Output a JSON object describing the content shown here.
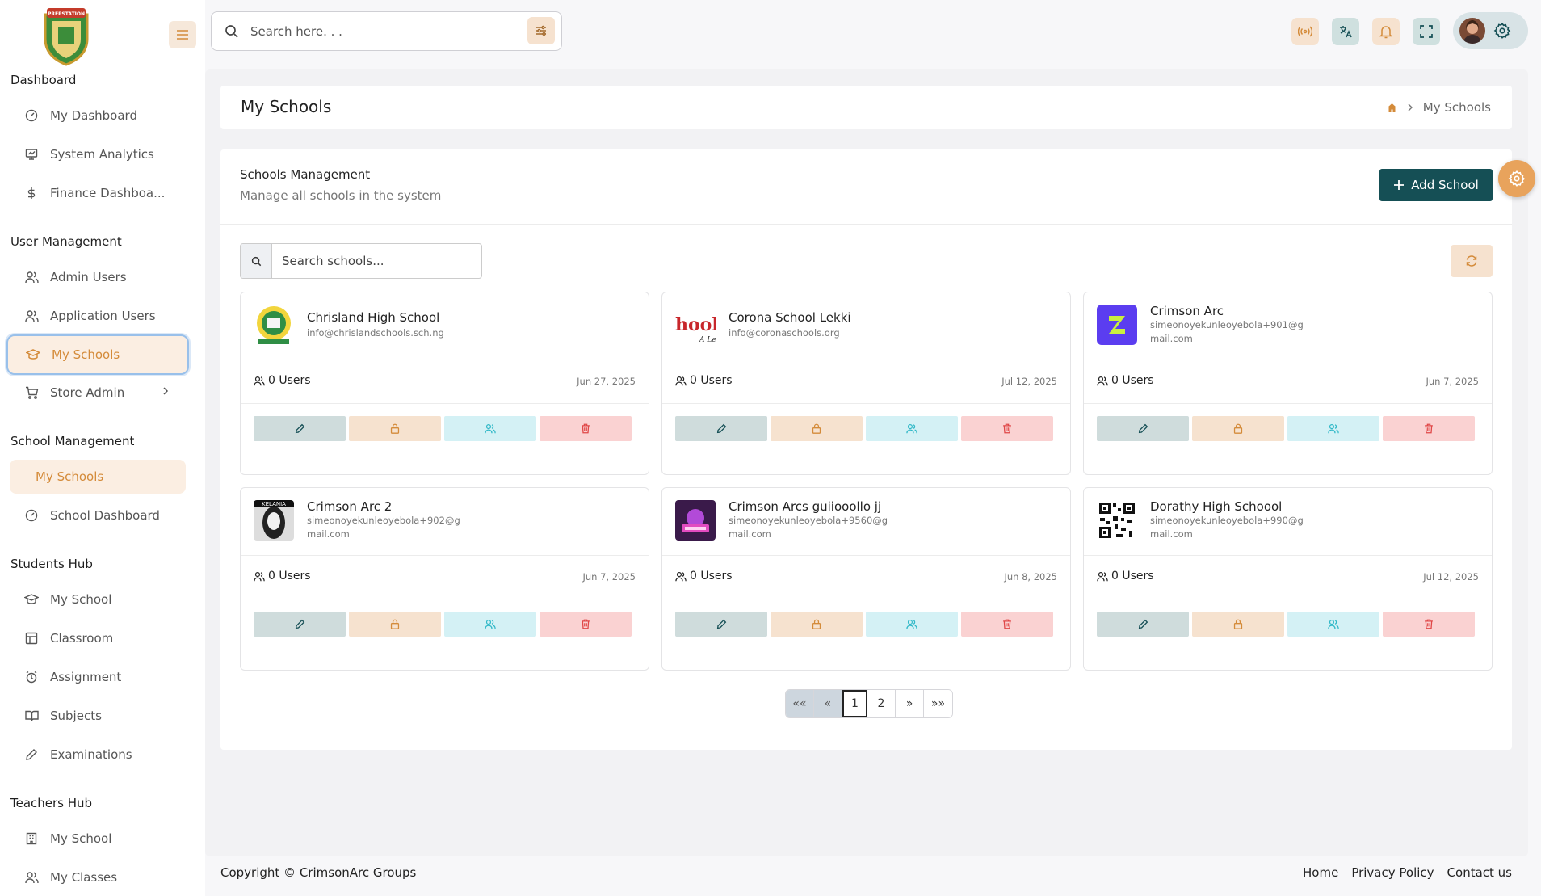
{
  "header": {
    "search_placeholder": "Search here. . ."
  },
  "sidebar": {
    "sections": [
      {
        "title": "Dashboard",
        "items": [
          "My Dashboard",
          "System Analytics",
          "Finance Dashboa..."
        ]
      },
      {
        "title": "User Management",
        "items": [
          "Admin Users",
          "Application Users",
          "My Schools",
          "Store Admin"
        ]
      },
      {
        "title": "School Management",
        "items": [
          "My Schools",
          "School Dashboard"
        ]
      },
      {
        "title": "Students Hub",
        "items": [
          "My School",
          "Classroom",
          "Assignment",
          "Subjects",
          "Examinations"
        ]
      },
      {
        "title": "Teachers Hub",
        "items": [
          "My School",
          "My Classes"
        ]
      }
    ]
  },
  "page": {
    "title": "My Schools",
    "breadcrumb_current": "My Schools"
  },
  "management": {
    "title": "Schools Management",
    "subtitle": "Manage all schools in the system",
    "add_label": "Add School",
    "search_placeholder": "Search schools..."
  },
  "schools": [
    {
      "name": "Chrisland High School",
      "email": "info@chrislandschools.sch.ng",
      "users": "0 Users",
      "date": "Jun 27, 2025"
    },
    {
      "name": "Corona School Lekki",
      "email": "info@coronaschools.org",
      "users": "0 Users",
      "date": "Jul 12, 2025"
    },
    {
      "name": "Crimson Arc",
      "email": "simeonoyekunleoyebola+901@gmail.com",
      "users": "0 Users",
      "date": "Jun 7, 2025"
    },
    {
      "name": "Crimson Arc 2",
      "email": "simeonoyekunleoyebola+902@gmail.com",
      "users": "0 Users",
      "date": "Jun 7, 2025"
    },
    {
      "name": "Crimson Arcs guiiooollo jj",
      "email": "simeonoyekunleoyebola+9560@gmail.com",
      "users": "0 Users",
      "date": "Jun 8, 2025"
    },
    {
      "name": "Dorathy High Schoool",
      "email": "simeonoyekunleoyebola+990@gmail.com",
      "users": "0 Users",
      "date": "Jul 12, 2025"
    }
  ],
  "logos": {
    "chrisland_badge": "PREPSTATION",
    "corona_text": "hools",
    "corona_sub": "A Le",
    "crimson2_text": "KELANIA"
  },
  "pagination": {
    "first": "««",
    "prev": "«",
    "pages": [
      "1",
      "2"
    ],
    "next": "»",
    "last": "»»"
  },
  "footer": {
    "copyright": "Copyright © CrimsonArc Groups",
    "links": [
      "Home",
      "Privacy Policy",
      "Contact us"
    ]
  },
  "colors": {
    "accent": "#d48b3a",
    "primary": "#154f55",
    "sidebar_active_bg": "#fbeee2"
  }
}
